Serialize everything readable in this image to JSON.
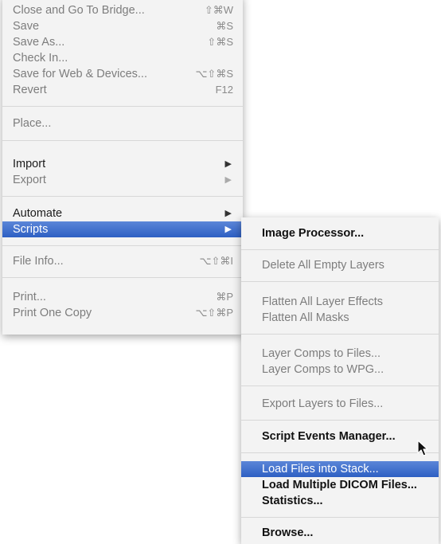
{
  "main_menu": {
    "items": [
      {
        "label": "Close and Go To Bridge...",
        "shortcut": "⇧⌘W"
      },
      {
        "label": "Save",
        "shortcut": "⌘S"
      },
      {
        "label": "Save As...",
        "shortcut": "⇧⌘S"
      },
      {
        "label": "Check In..."
      },
      {
        "label": "Save for Web & Devices...",
        "shortcut": "⌥⇧⌘S"
      },
      {
        "label": "Revert",
        "shortcut": "F12"
      },
      {
        "label": "Place..."
      },
      {
        "label": "Import"
      },
      {
        "label": "Export"
      },
      {
        "label": "Automate"
      },
      {
        "label": "Scripts"
      },
      {
        "label": "File Info...",
        "shortcut": "⌥⇧⌘I"
      },
      {
        "label": "Print...",
        "shortcut": "⌘P"
      },
      {
        "label": "Print One Copy",
        "shortcut": "⌥⇧⌘P"
      }
    ]
  },
  "scripts_submenu": {
    "items": [
      {
        "label": "Image Processor..."
      },
      {
        "label": "Delete All Empty Layers"
      },
      {
        "label": "Flatten All Layer Effects"
      },
      {
        "label": "Flatten All Masks"
      },
      {
        "label": "Layer Comps to Files..."
      },
      {
        "label": "Layer Comps to WPG..."
      },
      {
        "label": "Export Layers to Files..."
      },
      {
        "label": "Script Events Manager..."
      },
      {
        "label": "Load Files into Stack..."
      },
      {
        "label": "Load Multiple DICOM Files..."
      },
      {
        "label": "Statistics..."
      },
      {
        "label": "Browse..."
      }
    ]
  },
  "icons": {
    "submenu_arrow": "▶",
    "cursor": "mouse-pointer-icon"
  },
  "colors": {
    "highlight": "#3a6bcc",
    "menu_background": "#f3f3f3",
    "disabled_text": "#7d7d7d"
  }
}
